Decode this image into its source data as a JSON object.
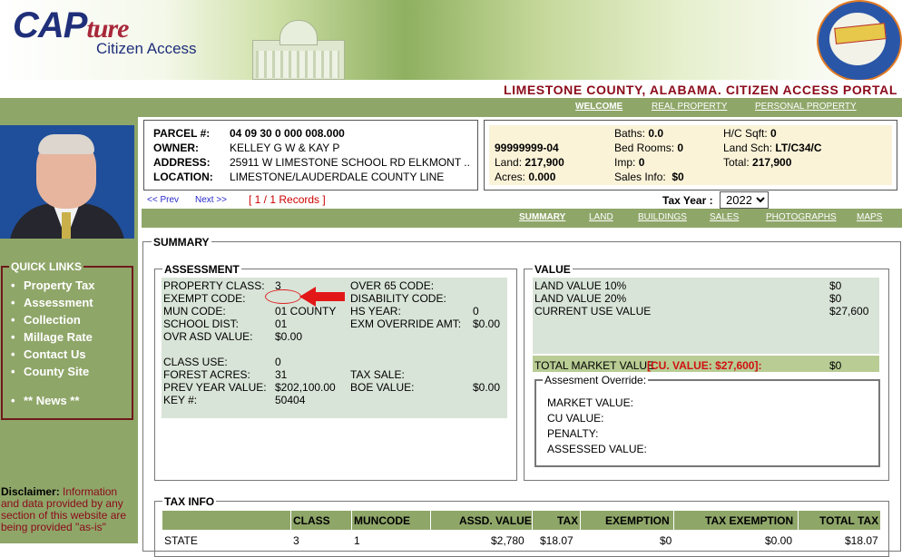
{
  "header": {
    "logo_main": "CAP",
    "logo_accent": "ture",
    "logo_sub": "Citizen Access",
    "portal_title": "LIMESTONE COUNTY, ALABAMA. CITIZEN ACCESS PORTAL"
  },
  "topnav": [
    {
      "label": "WELCOME",
      "active": true
    },
    {
      "label": "REAL PROPERTY",
      "active": false
    },
    {
      "label": "PERSONAL PROPERTY",
      "active": false
    }
  ],
  "quick_links": {
    "title": "QUICK LINKS",
    "items": [
      "Property Tax",
      "Assessment",
      "Collection",
      "Millage Rate",
      "Contact Us",
      "County Site"
    ],
    "news": "** News **"
  },
  "disclaimer": {
    "label": "Disclaimer:",
    "text": "Information and data provided by any section of this website are being provided \"as-is\""
  },
  "parcel": {
    "parcel_label": "PARCEL #:",
    "parcel_value": "04 09 30 0 000 008.000",
    "owner_label": "OWNER:",
    "owner_value": "KELLEY G W & KAY P",
    "address_label": "ADDRESS:",
    "address_value": "25911 W LIMESTONE SCHOOL RD ELKMONT ..",
    "location_label": "LOCATION:",
    "location_value": "LIMESTONE/LAUDERDALE COUNTY LINE"
  },
  "value_box": {
    "id": "99999999-04",
    "land_label": "Land:",
    "land_value": "217,900",
    "acres_label": "Acres:",
    "acres_value": "0.000",
    "baths_label": "Baths:",
    "baths_value": "0.0",
    "bedrooms_label": "Bed Rooms:",
    "bedrooms_value": "0",
    "imp_label": "Imp:",
    "imp_value": "0",
    "salesinfo_label": "Sales Info:",
    "salesinfo_value": "$0",
    "hc_label": "H/C Sqft:",
    "hc_value": "0",
    "landsch_label": "Land Sch:",
    "landsch_value": "LT/C34/C",
    "total_label": "Total:",
    "total_value": "217,900"
  },
  "records": {
    "prev": "<< Prev",
    "next": "Next >>",
    "count": "[ 1 / 1 Records ]",
    "tax_year_label": "Tax Year :",
    "tax_year": "2022"
  },
  "subnav": [
    {
      "label": "SUMMARY",
      "active": true
    },
    {
      "label": "LAND",
      "active": false
    },
    {
      "label": "BUILDINGS",
      "active": false
    },
    {
      "label": "SALES",
      "active": false
    },
    {
      "label": "PHOTOGRAPHS",
      "active": false
    },
    {
      "label": "MAPS",
      "active": false
    }
  ],
  "summary": {
    "title": "SUMMARY",
    "assessment": {
      "title": "ASSESSMENT",
      "property_class_label": "PROPERTY CLASS:",
      "property_class": "3",
      "exempt_code_label": "EXEMPT CODE:",
      "exempt_code": "",
      "mun_code_label": "MUN CODE:",
      "mun_code": "01 COUNTY",
      "school_dist_label": "SCHOOL DIST:",
      "school_dist": "01",
      "ovr_asd_label": "OVR ASD VALUE:",
      "ovr_asd": "$0.00",
      "class_use_label": "CLASS USE:",
      "class_use": "0",
      "forest_acres_label": "FOREST ACRES:",
      "forest_acres": "31",
      "prev_year_label": "PREV YEAR VALUE:",
      "prev_year": "$202,100.00",
      "key_label": "KEY #:",
      "key": "50404",
      "over65_label": "OVER 65 CODE:",
      "disability_label": "DISABILITY CODE:",
      "hs_year_label": "HS YEAR:",
      "hs_year": "0",
      "exm_override_label": "EXM OVERRIDE AMT:",
      "exm_override": "$0.00",
      "tax_sale_label": "TAX SALE:",
      "boe_label": "BOE VALUE:",
      "boe": "$0.00"
    },
    "value": {
      "title": "VALUE",
      "land10_label": "LAND VALUE 10%",
      "land10": "$0",
      "land20_label": "LAND VALUE 20%",
      "land20": "$0",
      "current_use_label": "CURRENT USE VALUE",
      "current_use": "$27,600",
      "total_market_label": "TOTAL MARKET VALUE",
      "cu_value_note": "[CU. VALUE: $27,600]:",
      "total_market": "$0",
      "override_title": "Assesment Override:",
      "override_market": "MARKET VALUE:",
      "override_cu": "CU VALUE:",
      "override_penalty": "PENALTY:",
      "override_assessed": "ASSESSED VALUE:"
    }
  },
  "tax_info": {
    "title": "TAX INFO",
    "columns": [
      "CLASS",
      "MUNCODE",
      "ASSD. VALUE",
      "TAX",
      "EXEMPTION",
      "TAX EXEMPTION",
      "TOTAL TAX"
    ],
    "row": {
      "name": "STATE",
      "class": "3",
      "muncode": "1",
      "assd_value": "$2,780",
      "tax": "$18.07",
      "exemption": "$0",
      "tax_exemption": "$0.00",
      "total_tax": "$18.07"
    }
  },
  "colors": {
    "nav_green": "#8fa669",
    "portal_red": "#8b0a1a",
    "panel_fill": "#d9e4d8",
    "info_yellow": "#fbf3d8"
  }
}
